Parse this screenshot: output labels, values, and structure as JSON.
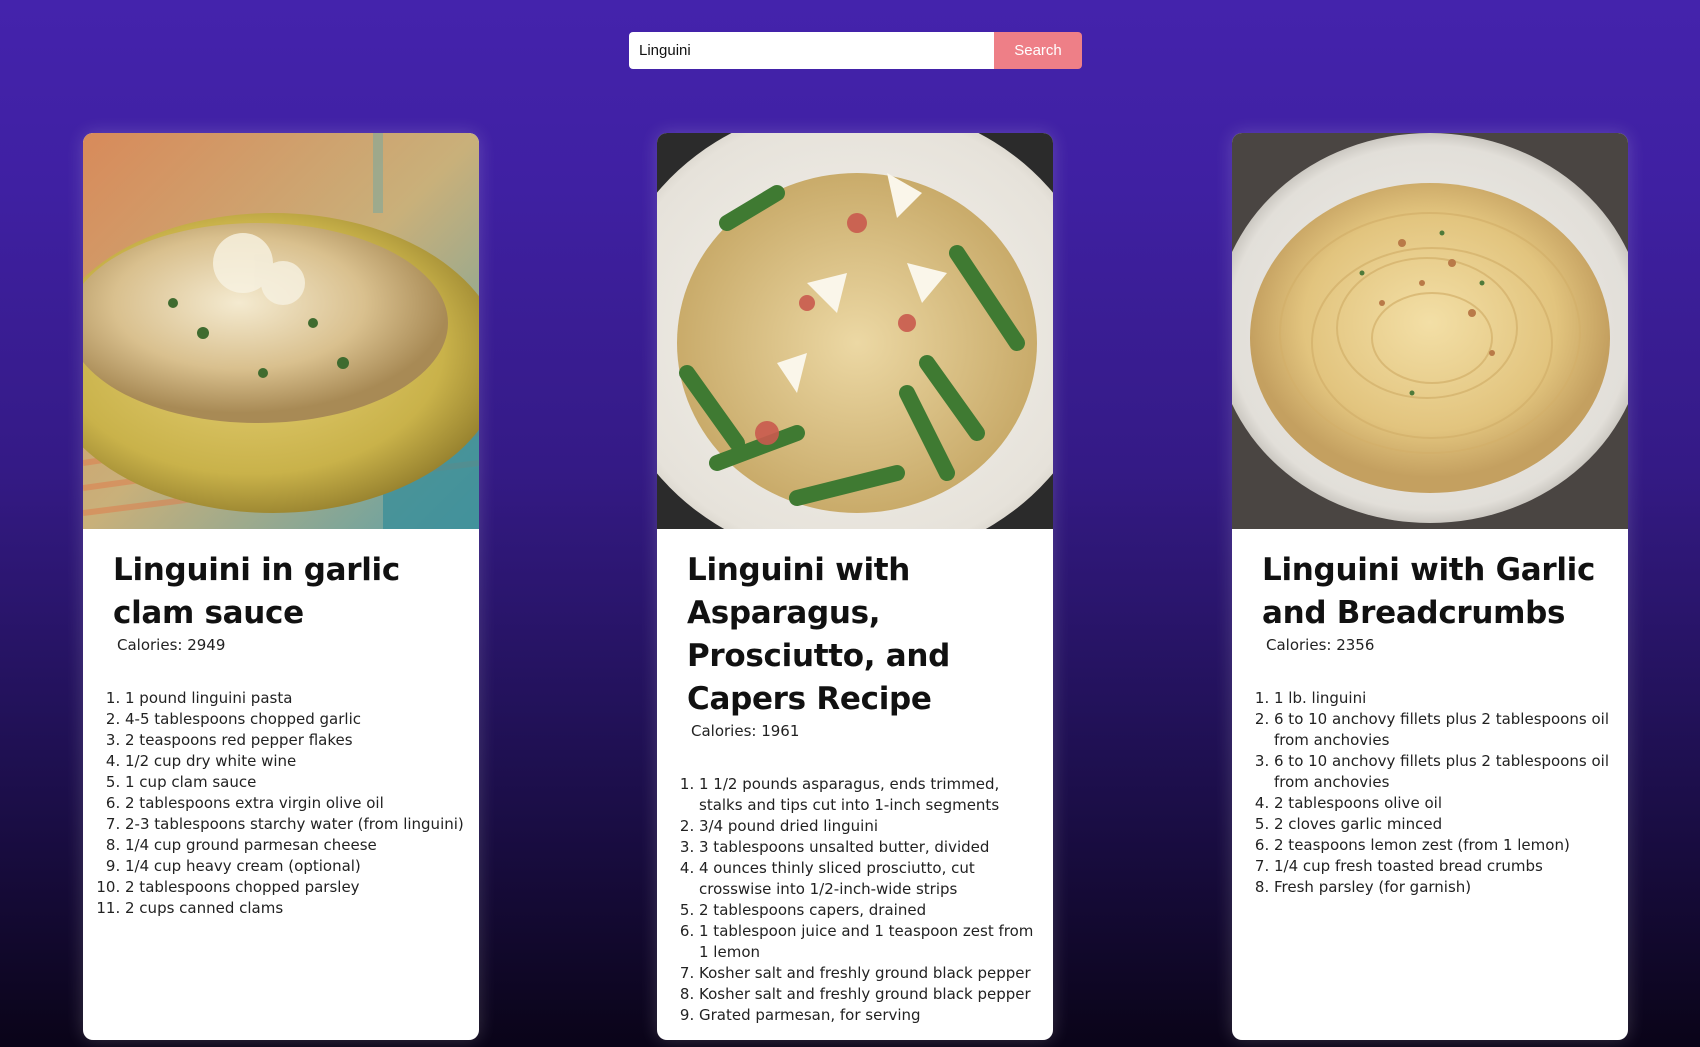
{
  "search": {
    "value": "Linguini",
    "button_label": "Search"
  },
  "cards": [
    {
      "image_alt": "Linguini in garlic clam sauce photo",
      "title": "Linguini in garlic clam sauce",
      "calories": "Calories: 2949",
      "ingredients": [
        "1 pound linguini pasta",
        "4-5 tablespoons chopped garlic",
        "2 teaspoons red pepper flakes",
        "1/2 cup dry white wine",
        "1 cup clam sauce",
        "2 tablespoons extra virgin olive oil",
        "2-3 tablespoons starchy water (from linguini)",
        "1/4 cup ground parmesan cheese",
        "1/4 cup heavy cream (optional)",
        "2 tablespoons chopped parsley",
        "2 cups canned clams"
      ]
    },
    {
      "image_alt": "Linguini with asparagus photo",
      "title": "Linguini with Asparagus, Prosciutto, and Capers Recipe",
      "calories": "Calories: 1961",
      "ingredients": [
        "1 1/2 pounds asparagus, ends trimmed, stalks and tips cut into 1-inch segments",
        "3/4 pound dried linguini",
        "3 tablespoons unsalted butter, divided",
        "4 ounces thinly sliced prosciutto, cut crosswise into 1/2-inch-wide strips",
        "2 tablespoons capers, drained",
        "1 tablespoon juice and 1 teaspoon zest from 1 lemon",
        "Kosher salt and freshly ground black pepper",
        "Kosher salt and freshly ground black pepper",
        "Grated parmesan, for serving"
      ]
    },
    {
      "image_alt": "Linguini with garlic and breadcrumbs photo",
      "title": "Linguini with Garlic and Breadcrumbs",
      "calories": "Calories: 2356",
      "ingredients": [
        "1 lb. linguini",
        "6 to 10 anchovy fillets plus 2 tablespoons oil from anchovies",
        "6 to 10 anchovy fillets plus 2 tablespoons oil from anchovies",
        "2 tablespoons olive oil",
        "2 cloves garlic minced",
        "2 teaspoons lemon zest (from 1 lemon)",
        "1/4 cup fresh toasted bread crumbs",
        "Fresh parsley (for garnish)"
      ]
    }
  ]
}
